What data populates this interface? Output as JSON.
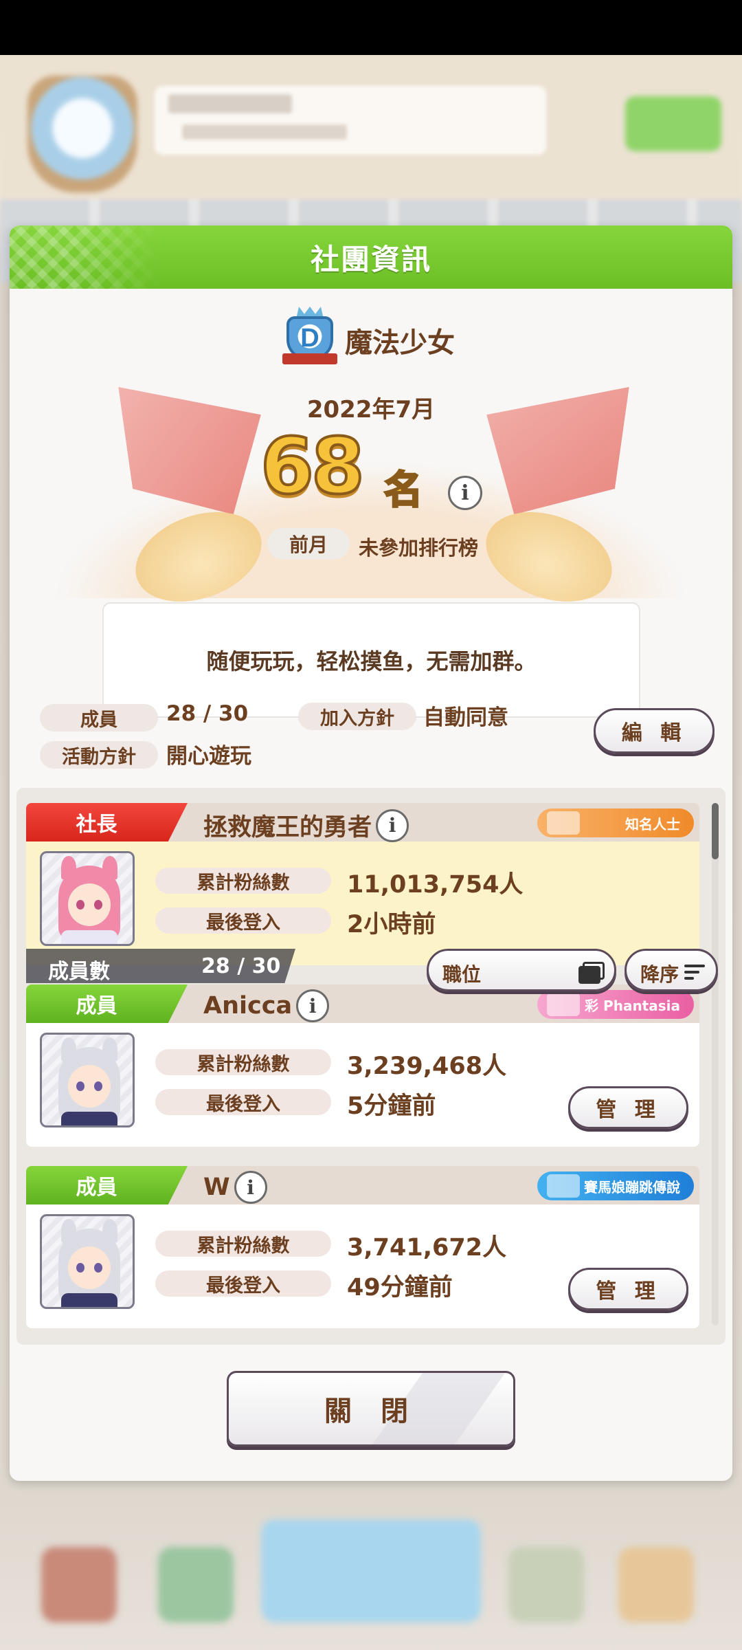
{
  "dialog": {
    "title": "社團資訊",
    "circle_name": "魔法少女",
    "rank_month": "2022年7月",
    "rank_number": "68",
    "rank_unit": "名",
    "prev_month_label": "前月",
    "prev_month_value": "未參加排行榜",
    "motto": "随便玩玩，轻松摸鱼，无需加群。",
    "members_label": "成員",
    "members_value": "28 / 30",
    "join_policy_label": "加入方針",
    "join_policy_value": "自動同意",
    "activity_label": "活動方針",
    "activity_value": "開心遊玩",
    "edit_button": "編 輯",
    "close_button": "關 閉"
  },
  "members": [
    {
      "role": "社長",
      "name": "拯救魔王的勇者",
      "badge": "知名人士",
      "fans_label": "累計粉絲數",
      "fans_value": "11,013,754人",
      "login_label": "最後登入",
      "login_value": "2小時前"
    },
    {
      "role": "成員",
      "name": "Anicca",
      "badge": "彩 Phantasia",
      "fans_label": "累計粉絲數",
      "fans_value": "3,239,468人",
      "login_label": "最後登入",
      "login_value": "5分鐘前",
      "manage_button": "管 理"
    },
    {
      "role": "成員",
      "name": "W",
      "badge": "賽馬娘蹦跳傳說",
      "fans_label": "累計粉絲數",
      "fans_value": "3,741,672人",
      "login_label": "最後登入",
      "login_value": "49分鐘前",
      "manage_button": "管 理"
    }
  ],
  "list_footer": {
    "count_label": "成員數",
    "count_value": "28 / 30",
    "sort_role": "職位",
    "sort_order": "降序"
  },
  "colors": {
    "header_green": "#6bbf25",
    "leader_red": "#d8261c",
    "text_brown": "#6b3f1f",
    "leader_card_bg": "#fdf3c8"
  }
}
